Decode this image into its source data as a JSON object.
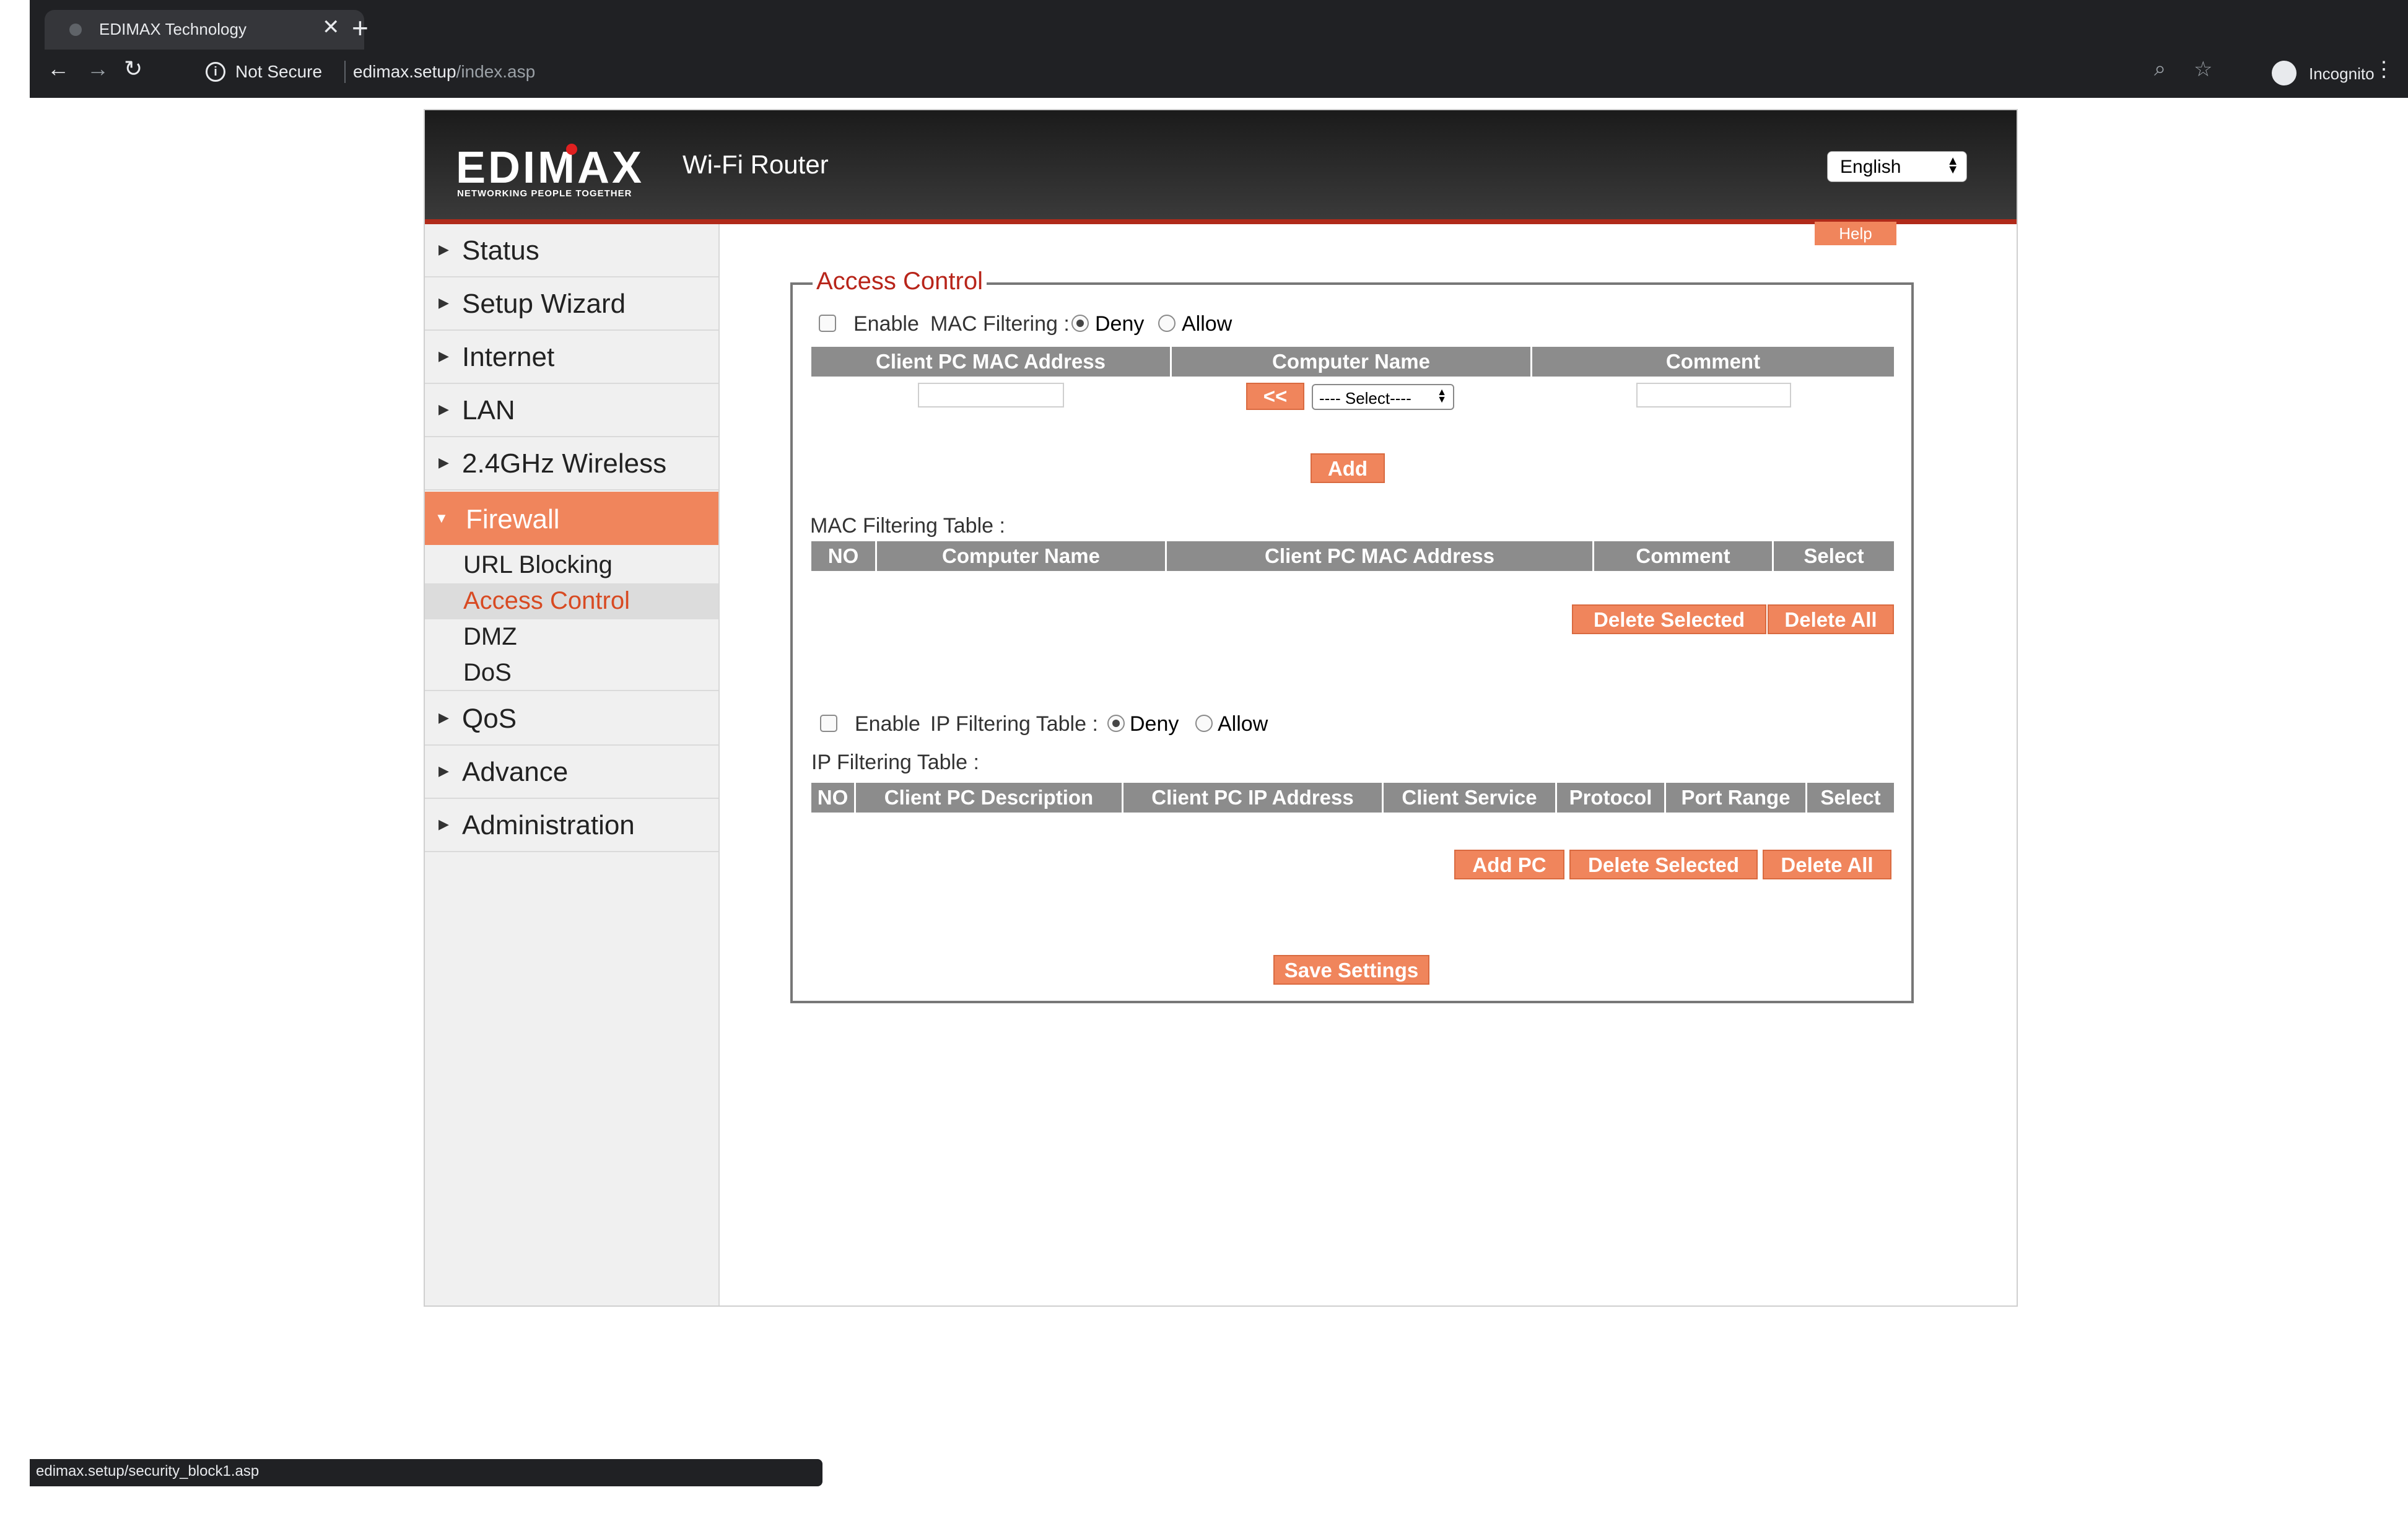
{
  "browser": {
    "tab_title": "EDIMAX Technology",
    "tab_close": "✕",
    "new_tab": "+",
    "not_secure": "Not Secure",
    "url_host": "edimax.setup",
    "url_path": "/index.asp",
    "incognito_label": "Incognito",
    "status_url": "edimax.setup/security_block1.asp"
  },
  "header": {
    "logo_text": "EDIMAX",
    "logo_tagline": "NETWORKING PEOPLE TOGETHER",
    "product": "Wi-Fi Router",
    "language": "English"
  },
  "sidebar": {
    "items": [
      {
        "label": "Status"
      },
      {
        "label": "Setup Wizard"
      },
      {
        "label": "Internet"
      },
      {
        "label": "LAN"
      },
      {
        "label": "2.4GHz Wireless"
      },
      {
        "label": "Firewall"
      },
      {
        "label": "QoS"
      },
      {
        "label": "Advance"
      },
      {
        "label": "Administration"
      }
    ],
    "firewall_sub": [
      {
        "label": "URL Blocking"
      },
      {
        "label": "Access Control"
      },
      {
        "label": "DMZ"
      },
      {
        "label": "DoS"
      }
    ]
  },
  "main": {
    "help": "Help",
    "legend": "Access Control",
    "mac": {
      "enable_label": "Enable",
      "filter_label": "MAC Filtering :",
      "deny": "Deny",
      "allow": "Allow",
      "input_headers": [
        "Client PC  MAC Address",
        "Computer Name",
        "Comment"
      ],
      "copy_btn": "<<",
      "select_value": "---- Select----",
      "add_btn": "Add",
      "table_label": "MAC Filtering  Table :",
      "table_headers": [
        "NO",
        "Computer Name",
        "Client PC  MAC Address",
        "Comment",
        "Select"
      ],
      "delete_selected": "Delete Selected",
      "delete_all": "Delete All"
    },
    "ip": {
      "enable_label": "Enable",
      "filter_label": "IP Filtering Table :",
      "deny": "Deny",
      "allow": "Allow",
      "table_label": "IP Filtering Table :",
      "table_headers": [
        "NO",
        "Client PC  Description",
        "Client PC  IP Address",
        "Client Service",
        "Protocol",
        "Port Range",
        "Select"
      ],
      "add_pc": "Add PC",
      "delete_selected": "Delete Selected",
      "delete_all": "Delete All"
    },
    "save_settings": "Save Settings"
  },
  "colors": {
    "accent": "#f0855c",
    "legend_red": "#b8251a",
    "table_header_gray": "#8c8c8c"
  }
}
